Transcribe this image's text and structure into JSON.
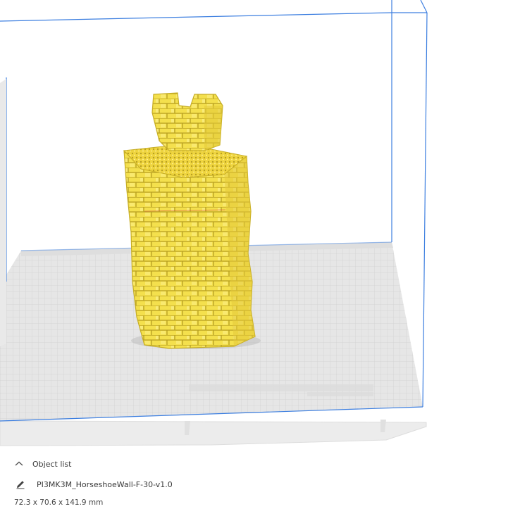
{
  "object_panel": {
    "header_label": "Object list",
    "header_icon": "chevron-up-icon",
    "object_name": "PI3MK3M_HorseshoeWall-F-30-v1.0",
    "object_icon": "pencil-icon",
    "dimensions": "72.3 x 70.6 x 141.9 mm"
  },
  "colors": {
    "model": "#f4e04d",
    "model_shadow": "#c8b22a",
    "build_plate": "#e6e6e6",
    "plate_grid": "#d2d2d2",
    "build_volume_edge": "#3d7fe0",
    "base": "#ececec"
  }
}
